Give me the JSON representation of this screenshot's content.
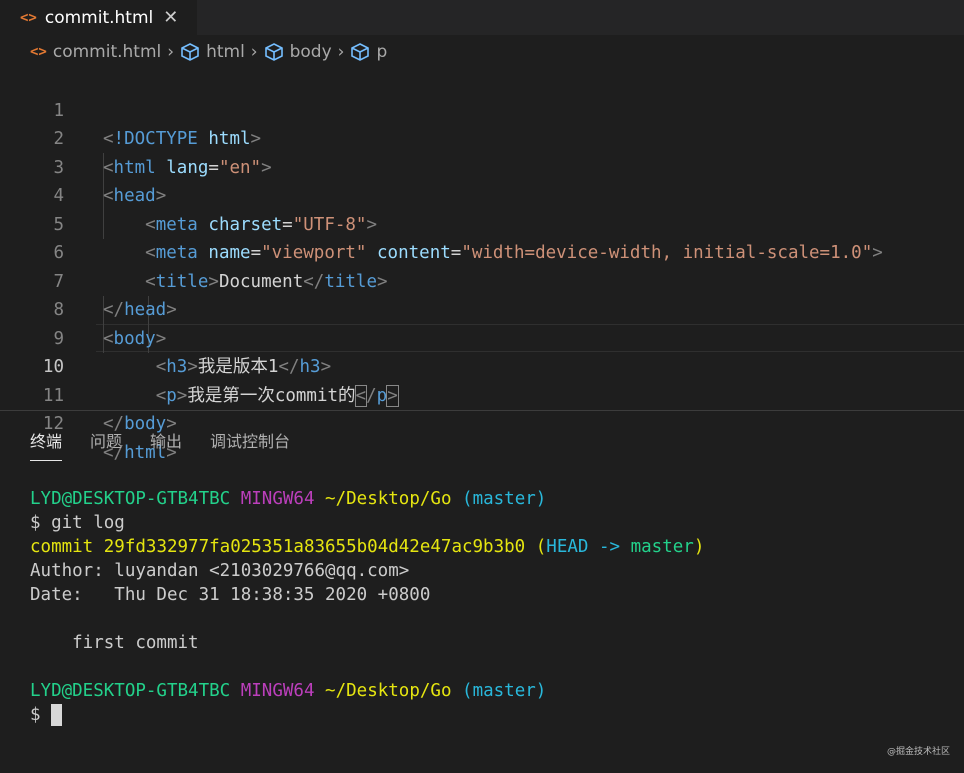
{
  "tab": {
    "filename": "commit.html",
    "close": "✕",
    "icon": "html-file-icon"
  },
  "breadcrumb": {
    "file": "commit.html",
    "items": [
      "html",
      "body",
      "p"
    ]
  },
  "editor": {
    "lines": [
      {
        "n": "1"
      },
      {
        "n": "2"
      },
      {
        "n": "3"
      },
      {
        "n": "4"
      },
      {
        "n": "5"
      },
      {
        "n": "6"
      },
      {
        "n": "7"
      },
      {
        "n": "8"
      },
      {
        "n": "9"
      },
      {
        "n": "10"
      },
      {
        "n": "11"
      },
      {
        "n": "12"
      }
    ],
    "active_line": "10",
    "code": {
      "doctype": "!DOCTYPE",
      "html": "html",
      "lang_attr": "lang",
      "lang_val": "\"en\"",
      "head": "head",
      "meta": "meta",
      "charset_attr": "charset",
      "charset_val": "\"UTF-8\"",
      "name_attr": "name",
      "name_val": "\"viewport\"",
      "content_attr": "content",
      "content_val": "\"width=device-width, initial-scale=1.0\"",
      "title": "title",
      "title_text": "Document",
      "body": "body",
      "h3": "h3",
      "h3_text": "我是版本1",
      "p": "p",
      "p_text": "我是第一次commit的"
    }
  },
  "panel": {
    "tabs": [
      "终端",
      "问题",
      "输出",
      "调试控制台"
    ],
    "active_tab": "终端"
  },
  "terminal": {
    "user_host": "LYD@DESKTOP-GTB4TBC",
    "env": "MINGW64",
    "path": "~/Desktop/Go",
    "branch": "(master)",
    "prompt": "$",
    "command": "git log",
    "commit_label": "commit",
    "commit_hash": "29fd332977fa025351a83655b04d42e47ac9b3b0",
    "ref_open": "(",
    "ref_head": "HEAD ->",
    "ref_branch": "master",
    "ref_close": ")",
    "author": "Author: luyandan <2103029766@qq.com>",
    "date": "Date:   Thu Dec 31 18:38:35 2020 +0800",
    "message": "    first commit"
  },
  "watermark": "@掘金技术社区",
  "colors": {
    "editor_bg": "#1e1e1e",
    "tag": "#569cd6",
    "attr": "#9cdcfe",
    "string": "#ce9178",
    "term_green": "#23d18b",
    "term_magenta": "#bc3fbc",
    "term_yellow": "#e5e510",
    "term_cyan": "#29b8db"
  }
}
